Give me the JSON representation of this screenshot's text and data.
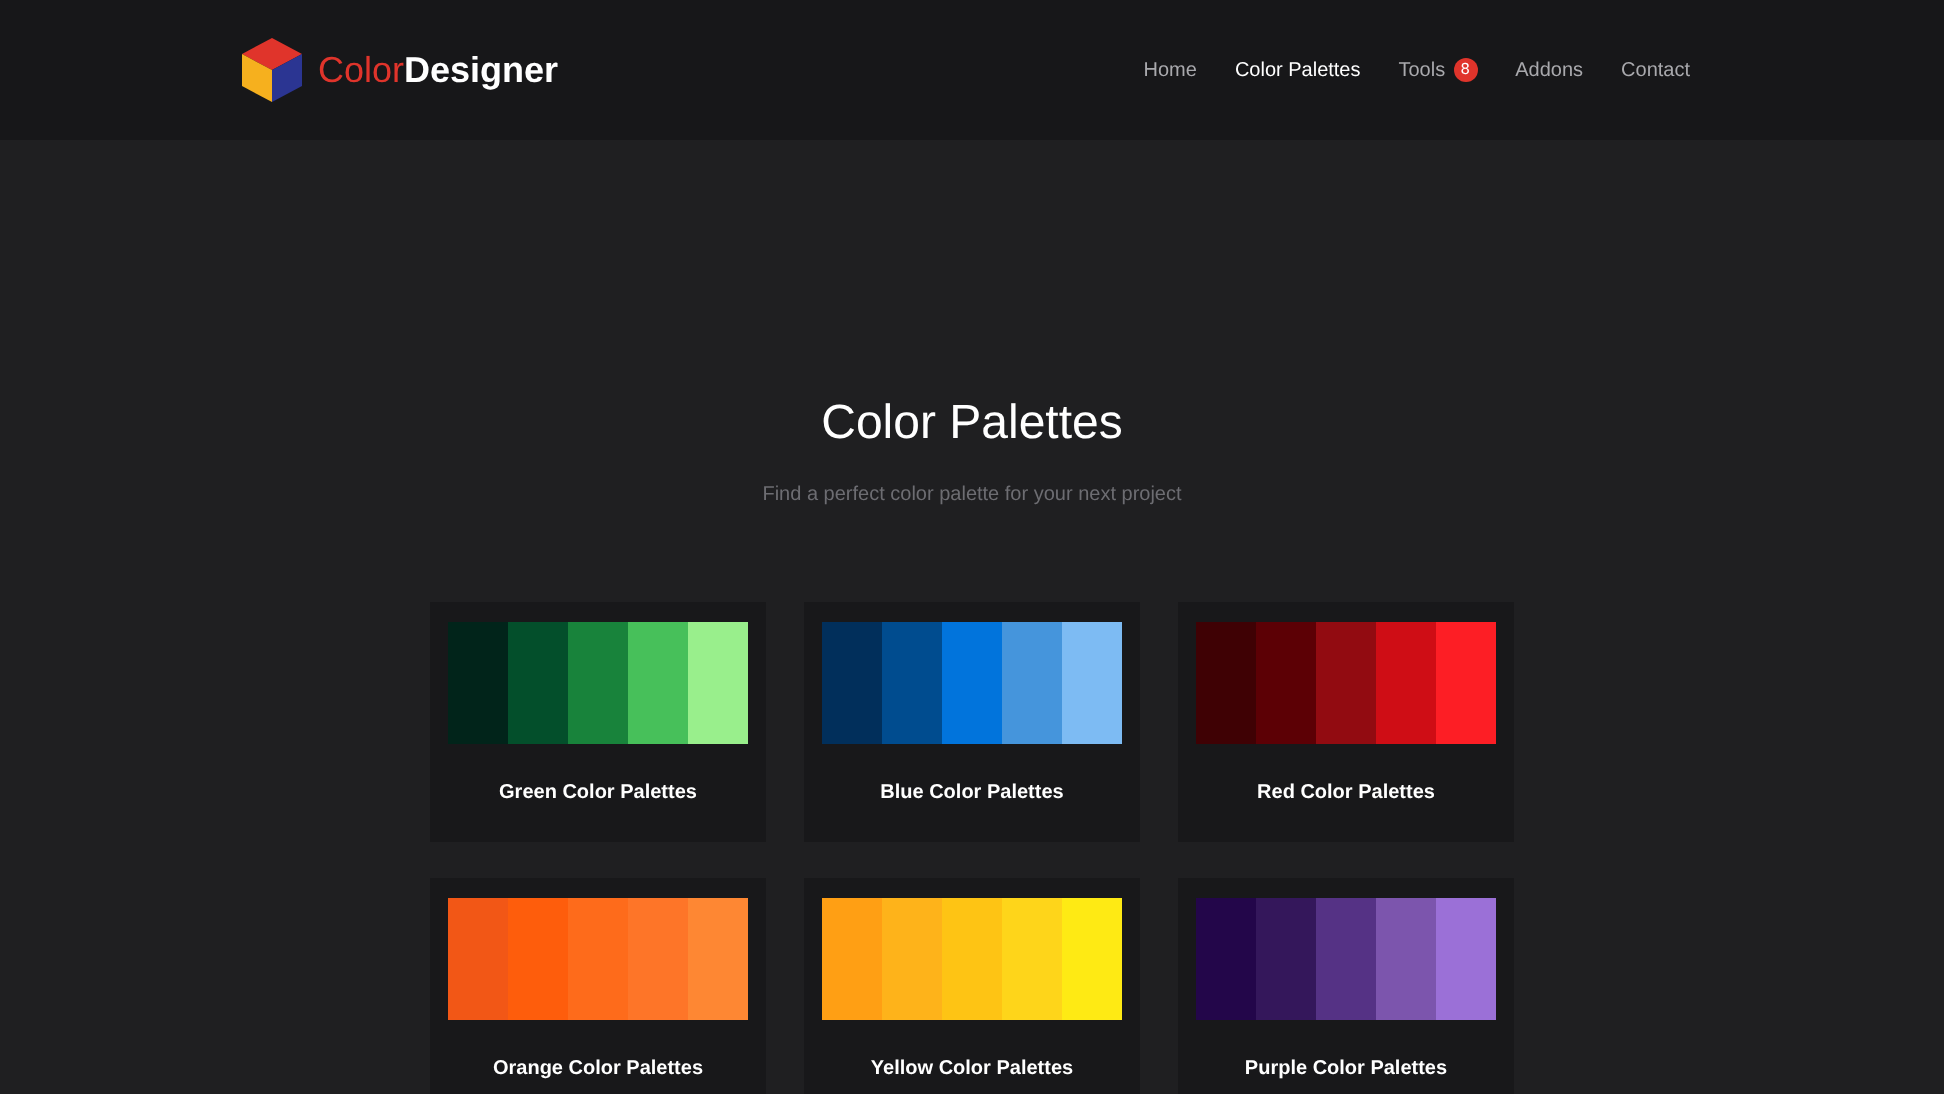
{
  "brand": {
    "first": "Color",
    "second": "Designer"
  },
  "nav": [
    {
      "label": "Home",
      "selected": false
    },
    {
      "label": "Color Palettes",
      "selected": true
    },
    {
      "label": "Tools",
      "selected": false,
      "badge": "8"
    },
    {
      "label": "Addons",
      "selected": false
    },
    {
      "label": "Contact",
      "selected": false
    }
  ],
  "hero": {
    "title": "Color Palettes",
    "subtitle": "Find a perfect color palette for your next project"
  },
  "palettes": [
    {
      "title": "Green Color Palettes",
      "swatches": [
        {
          "color": "#01241a"
        },
        {
          "color": "#034f2b"
        },
        {
          "color": "#18833b"
        },
        {
          "color": "#47c05a"
        },
        {
          "color": "#99ef8c"
        }
      ]
    },
    {
      "title": "Blue Color Palettes",
      "swatches": [
        {
          "color": "#012f5b"
        },
        {
          "color": "#004c8f"
        },
        {
          "color": "#0174dc"
        },
        {
          "color": "#4595dc"
        },
        {
          "color": "#7dbbf3"
        }
      ]
    },
    {
      "title": "Red Color Palettes",
      "swatches": [
        {
          "color": "#3f0104"
        },
        {
          "color": "#5c0005"
        },
        {
          "color": "#920b11"
        },
        {
          "color": "#cf0d15"
        },
        {
          "color": "#fd1e25"
        }
      ]
    },
    {
      "title": "Orange Color Palettes",
      "swatches": [
        {
          "color": "#f25716"
        },
        {
          "color": "#fe5d0c"
        },
        {
          "color": "#fe6b1b"
        },
        {
          "color": "#fe7528"
        },
        {
          "color": "#fe8733"
        }
      ]
    },
    {
      "title": "Yellow Color Palettes",
      "swatches": [
        {
          "color": "#ff9f14"
        },
        {
          "color": "#feb31a"
        },
        {
          "color": "#fec414"
        },
        {
          "color": "#fed51a"
        },
        {
          "color": "#feea14"
        }
      ]
    },
    {
      "title": "Purple Color Palettes",
      "swatches": [
        {
          "color": "#23064a"
        },
        {
          "color": "#34175b"
        },
        {
          "color": "#553285"
        },
        {
          "color": "#7c55ad"
        },
        {
          "color": "#9b70d7"
        }
      ]
    }
  ]
}
